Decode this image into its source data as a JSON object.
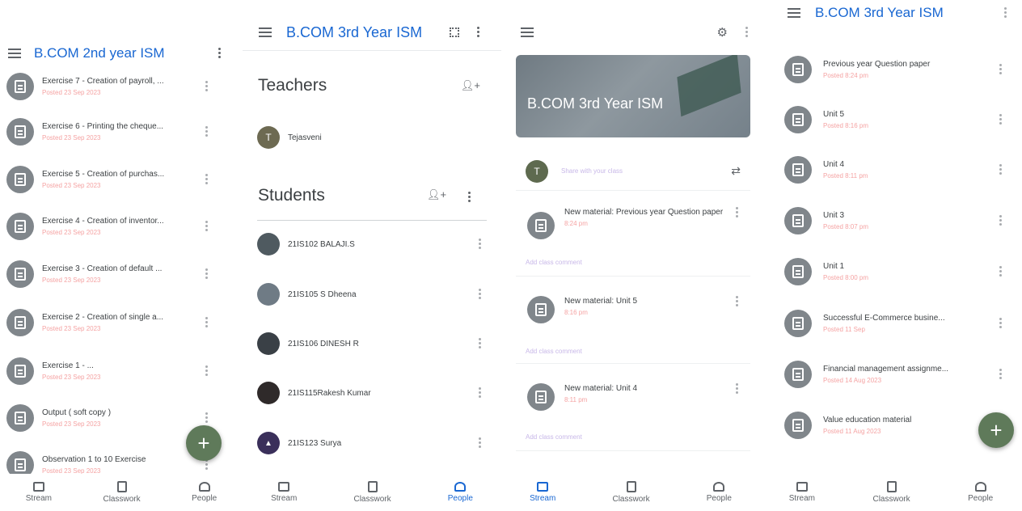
{
  "colors": {
    "accent": "#1967d2",
    "icon_gray": "#80868b",
    "fab": "#5f7a5a",
    "posted_text": "#f5a3a3"
  },
  "bottom_nav": {
    "stream": "Stream",
    "classwork": "Classwork",
    "people": "People"
  },
  "panel1": {
    "title": "B.COM 2nd year ISM",
    "items": [
      {
        "title": "Exercise 7 - Creation of payroll, ...",
        "posted": "Posted 23 Sep 2023"
      },
      {
        "title": "Exercise 6 - Printing the cheque...",
        "posted": "Posted 23 Sep 2023"
      },
      {
        "title": "Exercise 5 - Creation of purchas...",
        "posted": "Posted 23 Sep 2023"
      },
      {
        "title": "Exercise 4 - Creation of inventor...",
        "posted": "Posted 23 Sep 2023"
      },
      {
        "title": "Exercise 3 - Creation of default ...",
        "posted": "Posted 23 Sep 2023"
      },
      {
        "title": "Exercise 2 - Creation of single a...",
        "posted": "Posted 23 Sep 2023"
      },
      {
        "title": "Exercise 1 - ...",
        "posted": "Posted 23 Sep 2023"
      },
      {
        "title": "Output ( soft copy )",
        "posted": "Posted 23 Sep 2023"
      },
      {
        "title": "Observation 1 to 10 Exercise",
        "posted": "Posted 23 Sep 2023"
      }
    ]
  },
  "panel2": {
    "title": "B.COM 3rd Year ISM",
    "teachers_heading": "Teachers",
    "teacher": {
      "initial": "T",
      "name": "Tejasveni"
    },
    "students_heading": "Students",
    "students": [
      {
        "name": "21IS102 BALAJI.S"
      },
      {
        "name": "21IS105 S Dheena"
      },
      {
        "name": "21IS106 DINESH R"
      },
      {
        "name": "21IS115Rakesh Kumar"
      },
      {
        "name": "21IS123 Surya"
      }
    ]
  },
  "panel3": {
    "banner_title": "B.COM 3rd Year ISM",
    "teacher_initial": "T",
    "share_placeholder": "Share with your class",
    "add_comment": "Add class comment",
    "posts": [
      {
        "title": "New material: Previous year Question paper",
        "time": "8:24 pm"
      },
      {
        "title": "New material: Unit 5",
        "time": "8:16 pm"
      },
      {
        "title": "New material: Unit 4",
        "time": "8:11 pm"
      }
    ]
  },
  "panel4": {
    "title": "B.COM 3rd Year ISM",
    "items": [
      {
        "title": "Previous year Question paper",
        "posted": "Posted 8:24 pm"
      },
      {
        "title": "Unit 5",
        "posted": "Posted 8:16 pm"
      },
      {
        "title": "Unit 4",
        "posted": "Posted 8:11 pm"
      },
      {
        "title": "Unit 3",
        "posted": "Posted 8:07 pm"
      },
      {
        "title": "Unit 1",
        "posted": "Posted 8:00 pm"
      },
      {
        "title": "Successful E-Commerce busine...",
        "posted": "Posted 11 Sep"
      },
      {
        "title": "Financial management assignme...",
        "posted": "Posted 14 Aug 2023"
      },
      {
        "title": "Value education material",
        "posted": "Posted 11 Aug 2023"
      }
    ]
  }
}
